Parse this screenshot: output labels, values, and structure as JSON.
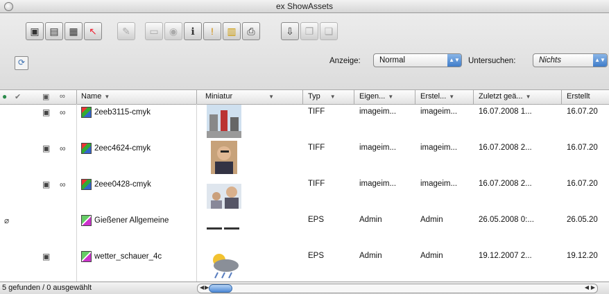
{
  "window": {
    "title": "ex ShowAssets"
  },
  "toolbar": {
    "group1": [
      "card-icon",
      "card-lock-icon",
      "grid-icon",
      "cursor-add-icon"
    ],
    "group2": [
      "pencil-icon",
      "window-icon",
      "eye-icon",
      "info-icon",
      "alert-icon",
      "stack-icon",
      "printer-icon"
    ],
    "group3": [
      "download-icon",
      "copy-icon",
      "paste-icon"
    ]
  },
  "filters": {
    "anzeige_label": "Anzeige:",
    "anzeige_value": "Normal",
    "untersuchen_label": "Untersuchen:",
    "untersuchen_value": "Nichts"
  },
  "table": {
    "columns": [
      "Name",
      "Miniatur",
      "Typ",
      "Eigen...",
      "Erstel...",
      "Zuletzt geä...",
      "Erstellt"
    ],
    "rows": [
      {
        "name": "2eeb3115-cmyk",
        "type": "TIFF",
        "owner": "imageim...",
        "creator": "imageim...",
        "modified": "16.07.2008 1...",
        "created": "16.07.20",
        "icon": "tiff",
        "thumb": "street-photo"
      },
      {
        "name": "2eec4624-cmyk",
        "type": "TIFF",
        "owner": "imageim...",
        "creator": "imageim...",
        "modified": "16.07.2008 2...",
        "created": "16.07.20",
        "icon": "tiff",
        "thumb": "portrait-photo"
      },
      {
        "name": "2eee0428-cmyk",
        "type": "TIFF",
        "owner": "imageim...",
        "creator": "imageim...",
        "modified": "16.07.2008 2...",
        "created": "16.07.20",
        "icon": "tiff",
        "thumb": "people-photo"
      },
      {
        "name": "Gießener Allgemeine",
        "type": "EPS",
        "owner": "Admin",
        "creator": "Admin",
        "modified": "26.05.2008 0:...",
        "created": "26.05.20",
        "icon": "eps",
        "thumb": "logo-text"
      },
      {
        "name": "wetter_schauer_4c",
        "type": "EPS",
        "owner": "Admin",
        "creator": "Admin",
        "modified": "19.12.2007 2...",
        "created": "19.12.20",
        "icon": "eps",
        "thumb": "weather-icon"
      }
    ]
  },
  "status": {
    "text": "5 gefunden / 0 ausgewählt"
  }
}
